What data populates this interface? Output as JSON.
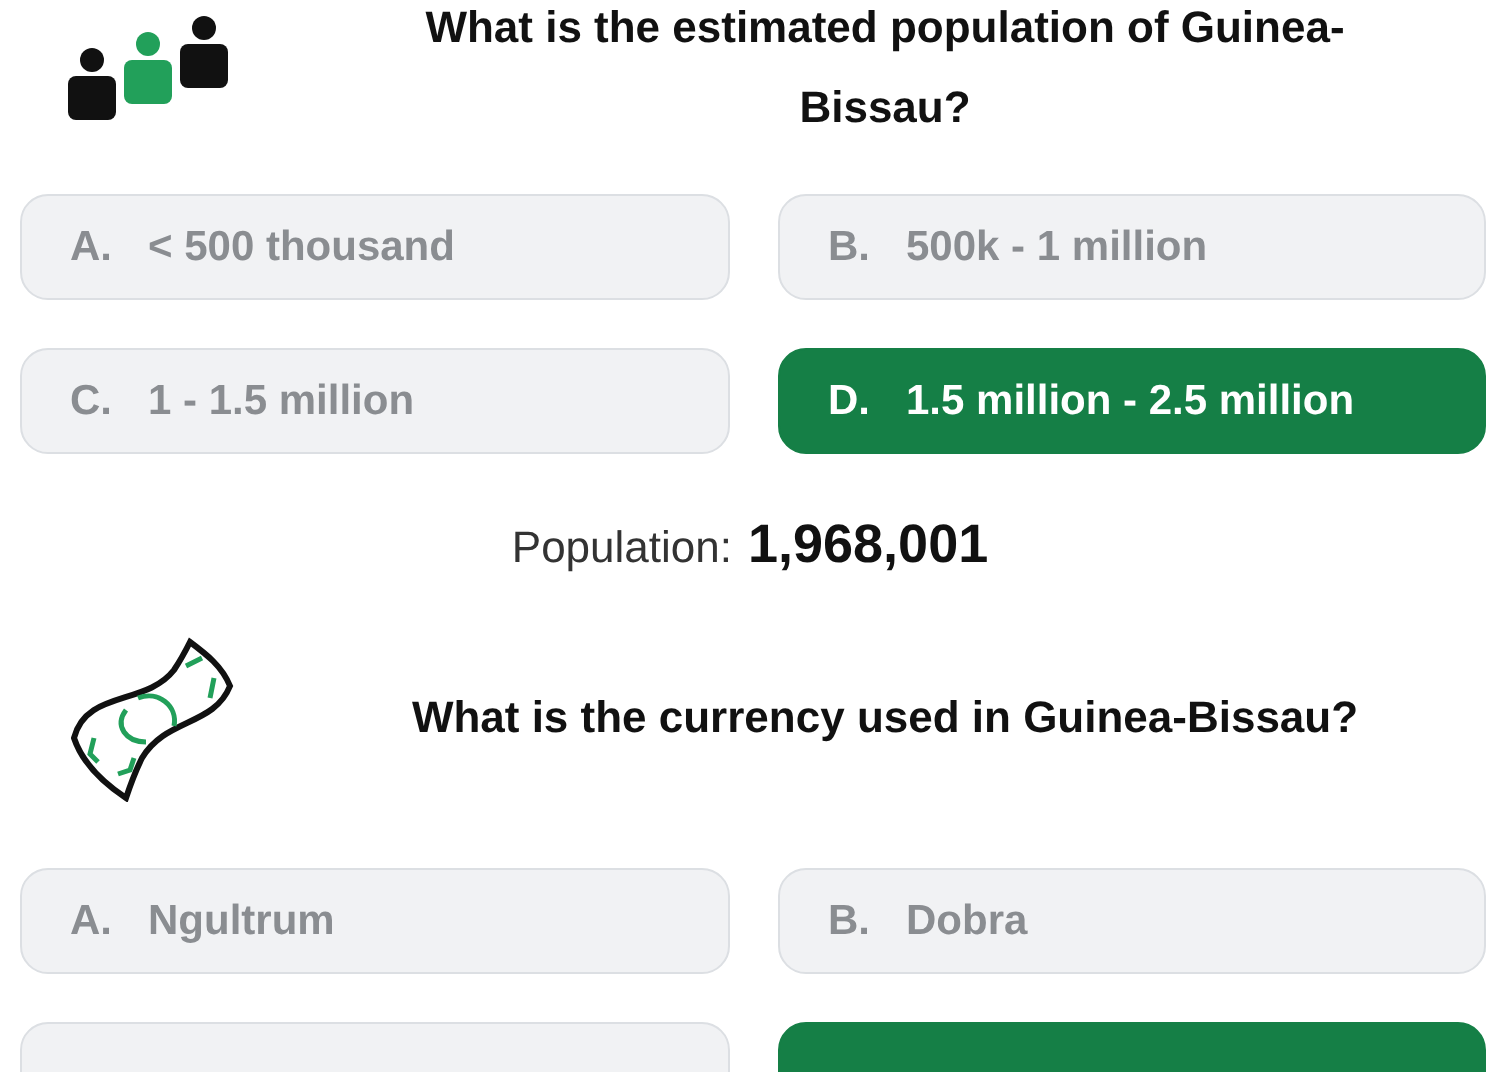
{
  "quizzes": [
    {
      "kind": "people",
      "question": "What is the estimated population of Guinea-Bissau?",
      "options": [
        {
          "letter": "A.",
          "text": "< 500 thousand",
          "selected": false
        },
        {
          "letter": "B.",
          "text": "500k - 1 million",
          "selected": false
        },
        {
          "letter": "C.",
          "text": "1 - 1.5 million",
          "selected": false
        },
        {
          "letter": "D.",
          "text": "1.5 million - 2.5 million",
          "selected": true
        }
      ],
      "answer": {
        "label": "Population:",
        "value": "1,968,001"
      }
    },
    {
      "kind": "banknote",
      "question": "What is the currency used in Guinea-Bissau?",
      "options": [
        {
          "letter": "A.",
          "text": "Ngultrum",
          "selected": false
        },
        {
          "letter": "B.",
          "text": "Dobra",
          "selected": false
        },
        {
          "selected": false
        },
        {
          "selected": true
        }
      ]
    }
  ]
}
